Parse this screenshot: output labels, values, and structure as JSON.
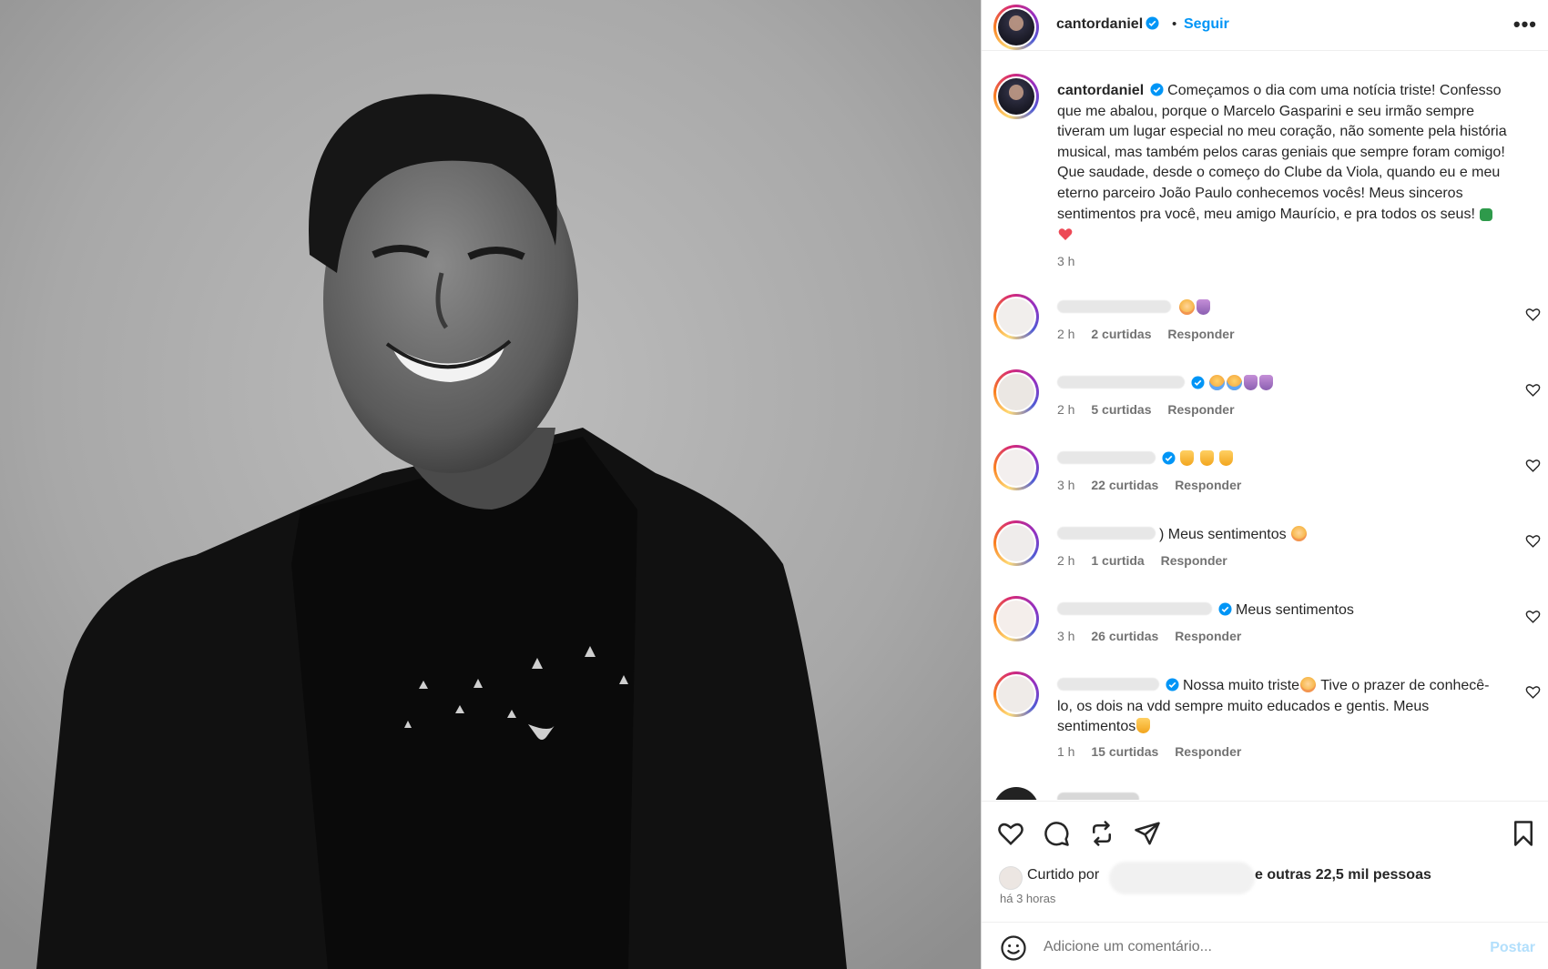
{
  "header": {
    "username": "cantordaniel",
    "separator": "•",
    "follow_label": "Seguir",
    "more_icon": "more-options-icon",
    "more_glyph": "•••"
  },
  "caption": {
    "username": "cantordaniel",
    "text": "Começamos o dia com uma notícia triste! Confesso que me abalou, porque o Marcelo Gasparini e seu irmão sempre tiveram um lugar especial no meu coração, não somente pela história musical, mas também pelos caras geniais que sempre foram comigo! Que saudade, desde o começo do Clube da Viola, quando eu e meu eterno parceiro João Paulo conhecemos vocês! Meus sinceros sentimentos pra você, meu amigo Maurício, e pra todos os seus!",
    "time": "3 h"
  },
  "comments": [
    {
      "time": "2 h",
      "likes": "2 curtidas",
      "reply": "Responder",
      "text": ""
    },
    {
      "time": "2 h",
      "likes": "5 curtidas",
      "reply": "Responder",
      "text": ""
    },
    {
      "time": "3 h",
      "likes": "22 curtidas",
      "reply": "Responder",
      "text": ""
    },
    {
      "time": "2 h",
      "likes": "1 curtida",
      "reply": "Responder",
      "text": ") Meus sentimentos"
    },
    {
      "time": "3 h",
      "likes": "26 curtidas",
      "reply": "Responder",
      "text": "Meus sentimentos"
    },
    {
      "time": "1 h",
      "likes": "15 curtidas",
      "reply": "Responder",
      "text_1": "Nossa muito triste",
      "text_2": "Tive o prazer de conhecê-lo, os dois na vdd sempre muito educados e gentis. Meus sentimentos"
    }
  ],
  "actions": {
    "like_icon": "heart-icon",
    "comment_icon": "comment-icon",
    "repost_icon": "repost-icon",
    "share_icon": "share-icon",
    "save_icon": "bookmark-icon"
  },
  "likes": {
    "prefix": "Curtido por",
    "suffix": "e outras 22,5 mil pessoas"
  },
  "post_time": "há 3 horas",
  "add_comment": {
    "placeholder": "Adicione um comentário...",
    "post_label": "Postar"
  },
  "colors": {
    "accent": "#0095f6",
    "post_disabled": "#b2dffc",
    "secondary_text": "#737373",
    "verified": "#0095f6",
    "heart_red": "#ed4956"
  }
}
